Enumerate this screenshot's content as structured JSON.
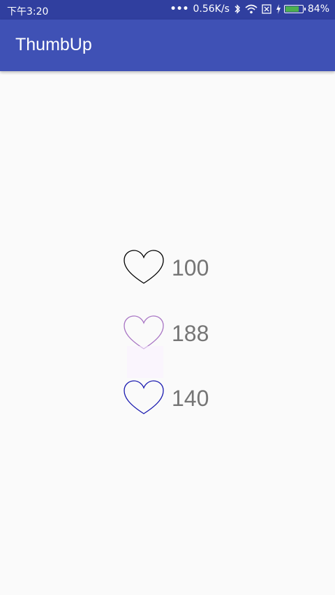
{
  "status_bar": {
    "time": "下午3:20",
    "dots": "•••",
    "network_speed": "0.56K/s",
    "icons": [
      "bluetooth-icon",
      "wifi-icon",
      "sim-disabled-icon",
      "charging-bolt-icon",
      "battery-icon"
    ],
    "battery_percent": "84%",
    "battery_level": 0.84,
    "battery_color": "#4caf50"
  },
  "app_bar": {
    "title": "ThumbUp",
    "color": "#3f51b5",
    "status_color": "#303f9f"
  },
  "thumb_views": [
    {
      "count": "100",
      "heart_color": "#000000",
      "icon": "heart-outline-icon"
    },
    {
      "count": "188",
      "heart_color": "#a874c4",
      "icon": "heart-outline-icon"
    },
    {
      "count": "140",
      "heart_color": "#1a1ab0",
      "icon": "heart-outline-icon"
    }
  ]
}
